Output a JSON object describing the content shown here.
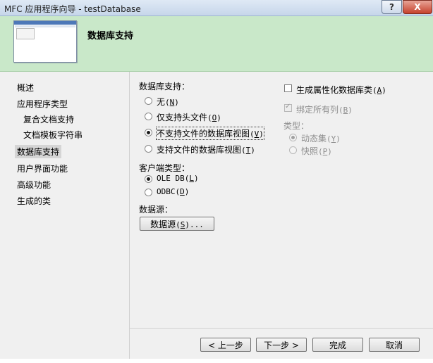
{
  "window": {
    "title": "MFC 应用程序向导 - testDatabase",
    "help_label": "?",
    "close_label": "X"
  },
  "header": {
    "page_title": "数据库支持"
  },
  "nav": {
    "items": [
      {
        "label": "概述"
      },
      {
        "label": "应用程序类型"
      },
      {
        "label": "复合文档支持"
      },
      {
        "label": "文档模板字符串"
      },
      {
        "label": "数据库支持",
        "active": true
      },
      {
        "label": "用户界面功能"
      },
      {
        "label": "高级功能"
      },
      {
        "label": "生成的类"
      }
    ]
  },
  "database_support": {
    "label": "数据库支持：",
    "options": [
      {
        "label": "无(N)",
        "text": "无",
        "key": "N",
        "selected": false
      },
      {
        "label": "仅支持头文件(O)",
        "text": "仅支持头文件",
        "key": "O",
        "selected": false
      },
      {
        "label": "不支持文件的数据库视图(V)",
        "text": "不支持文件的数据库视图",
        "key": "V",
        "selected": true
      },
      {
        "label": "支持文件的数据库视图(T)",
        "text": "支持文件的数据库视图",
        "key": "T",
        "selected": false
      }
    ]
  },
  "client_type": {
    "label": "客户端类型：",
    "options": [
      {
        "text": "OLE DB",
        "key": "L",
        "selected": true
      },
      {
        "text": "ODBC",
        "key": "D",
        "selected": false
      }
    ]
  },
  "data_source": {
    "label": "数据源：",
    "button_text": "数据源",
    "button_key": "S",
    "button_suffix": "..."
  },
  "right_options": {
    "generate_attributed": {
      "text": "生成属性化数据库类",
      "key": "A",
      "checked": false,
      "enabled": true
    },
    "bind_all_columns": {
      "text": "绑定所有列",
      "key": "B",
      "checked": true,
      "enabled": false
    },
    "type_label": "类型：",
    "type_options": [
      {
        "text": "动态集",
        "key": "Y",
        "selected": true,
        "enabled": false
      },
      {
        "text": "快照",
        "key": "P",
        "selected": false,
        "enabled": false
      }
    ]
  },
  "footer": {
    "back_label": "< 上一步",
    "next_label": "下一步 >",
    "finish_label": "完成",
    "cancel_label": "取消"
  },
  "colors": {
    "header_bg": "#c9e8c9",
    "window_bg": "#f0f0f0",
    "close_button": "#c6412c"
  }
}
